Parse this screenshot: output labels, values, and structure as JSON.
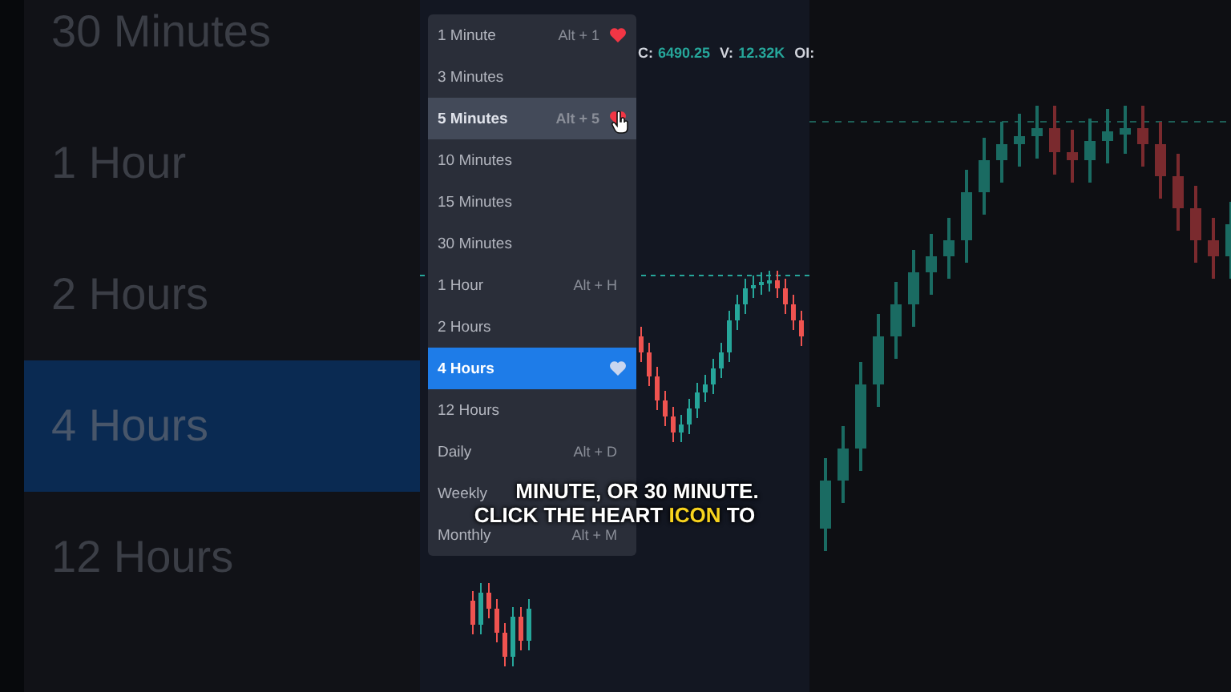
{
  "backdrop_items": [
    {
      "label": "30 Minutes",
      "selected": false
    },
    {
      "label": "1 Hour",
      "selected": false
    },
    {
      "label": "2 Hours",
      "selected": false
    },
    {
      "label": "4 Hours",
      "selected": true
    },
    {
      "label": "12 Hours",
      "selected": false
    }
  ],
  "chart_header": [
    {
      "key": "C:",
      "value": "6490.25"
    },
    {
      "key": "V:",
      "value": "12.32K"
    },
    {
      "key": "OI:"
    }
  ],
  "interval_menu": [
    {
      "label": "1 Minute",
      "shortcut": "Alt + 1",
      "favorite": true,
      "selected": false,
      "hovered": false
    },
    {
      "label": "3 Minutes",
      "favorite": false,
      "selected": false,
      "hovered": false
    },
    {
      "label": "5 Minutes",
      "shortcut": "Alt + 5",
      "favorite": true,
      "selected": false,
      "hovered": true
    },
    {
      "label": "10 Minutes",
      "favorite": false,
      "selected": false,
      "hovered": false
    },
    {
      "label": "15 Minutes",
      "favorite": false,
      "selected": false,
      "hovered": false
    },
    {
      "label": "30 Minutes",
      "favorite": false,
      "selected": false,
      "hovered": false
    },
    {
      "label": "1 Hour",
      "shortcut": "Alt + H",
      "favorite": false,
      "selected": false,
      "hovered": false
    },
    {
      "label": "2 Hours",
      "favorite": false,
      "selected": false,
      "hovered": false
    },
    {
      "label": "4 Hours",
      "favorite": false,
      "selected": true,
      "hovered": false
    },
    {
      "label": "12 Hours",
      "favorite": false,
      "selected": false,
      "hovered": false
    },
    {
      "label": "Daily",
      "shortcut": "Alt + D",
      "favorite": false,
      "selected": false,
      "hovered": false
    },
    {
      "label": "Weekly",
      "favorite": false,
      "selected": false,
      "hovered": false
    },
    {
      "label": "Monthly",
      "shortcut": "Alt + M",
      "favorite": false,
      "selected": false,
      "hovered": false
    }
  ],
  "caption": [
    [
      {
        "text": "MINUTE, OR 30 MINUTE.",
        "highlight": false
      }
    ],
    [
      {
        "text": "CLICK THE HEART ",
        "highlight": false
      },
      {
        "text": "ICON",
        "highlight": true
      },
      {
        "text": " TO",
        "highlight": false
      }
    ]
  ]
}
